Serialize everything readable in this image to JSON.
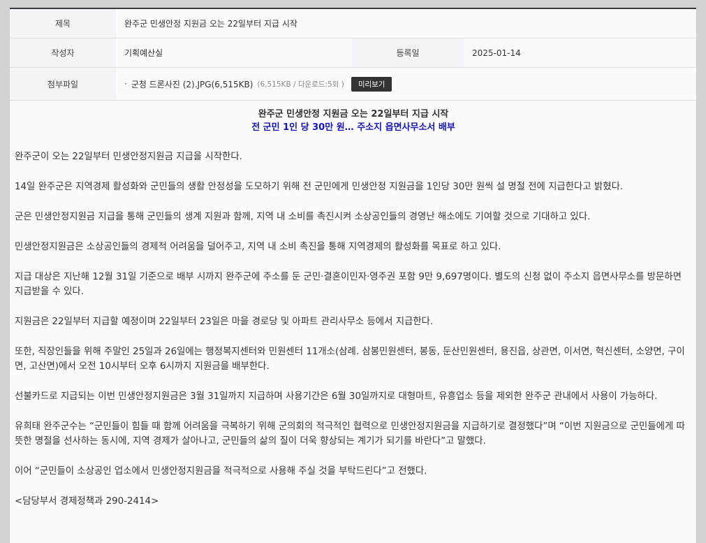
{
  "meta": {
    "title_label": "제목",
    "title_value": "완주군 민생안정 지원금 오는 22일부터 지급 시작",
    "author_label": "작성자",
    "author_value": "기획예산실",
    "date_label": "등록일",
    "date_value": "2025-01-14",
    "attach_label": "첨부파일",
    "attach_bullet": "·",
    "attach_name": "군청 드론사진 (2).JPG(6,515KB)",
    "attach_info": "(6,515KB / 다운로드:5회 )",
    "preview_label": "미리보기"
  },
  "article": {
    "headline": "완주군 민생안정 지원금 오는 22일부터 지급 시작",
    "subheadline": "전 군민 1인 당 30만 원… 주소지 읍면사무소서 배부",
    "paragraphs": [
      "완주군이 오는 22일부터 민생안정지원금 지급을 시작한다.",
      "14일 완주군은 지역경제 활성화와 군민들의 생활 안정성을 도모하기 위해 전 군민에게 민생안정 지원금을 1인당 30만 원씩 설 명절 전에 지급한다고 밝혔다.",
      "군은 민생안정지원금 지급을 통해 군민들의 생계 지원과 함께, 지역 내 소비를 촉진시켜 소상공인들의 경영난 해소에도 기여할 것으로 기대하고 있다.",
      "민생안정지원금은 소상공인들의 경제적 어려움을 덜어주고, 지역 내 소비 촉진을 통해 지역경제의 활성화를 목표로 하고 있다.",
      "지급 대상은 지난해 12월 31일 기준으로 배부 시까지 완주군에 주소를 둔 군민·결혼이민자·영주권 포함 9만 9,697명이다. 별도의 신청 없이 주소지 읍면사무소를 방문하면 지급받을 수 있다.",
      "지원금은 22일부터 지급할 예정이며 22일부터 23일은 마을 경로당 및 아파트 관리사무소 등에서 지급한다.",
      "또한, 직장인들을 위해 주말인 25일과 26일에는 행정복지센터와 민원센터 11개소(삼례. 삼봉민원센터, 봉동, 둔산민원센터, 용진읍, 상관면, 이서면, 혁신센터, 소양면, 구이면, 고산면)에서 오전 10시부터 오후 6시까지 지원금을 배부한다.",
      "선불카드로 지급되는 이번 민생안정지원금은 3월 31일까지 지급하며 사용기간은 6월 30일까지로 대형마트, 유흥업소 등을 제외한 완주군 관내에서 사용이 가능하다.",
      "유희태 완주군수는 “군민들이 힘들 때 함께 어려움을 극복하기 위해 군의회의 적극적인 협력으로 민생안정지원금을 지급하기로 결정했다”며 “이번 지원금으로 군민들에게 따뜻한 명절을 선사하는 동시에, 지역 경제가 살아나고, 군민들의 삶의 질이 더욱 향상되는 계기가 되기를 바란다”고 말했다.",
      "이어 “군민들이 소상공인 업소에서 민생안정지원금을 적극적으로 사용해 주실 것을 부탁드린다”고 전했다.",
      "<담당부서 경제정책과 290-2414>"
    ]
  }
}
